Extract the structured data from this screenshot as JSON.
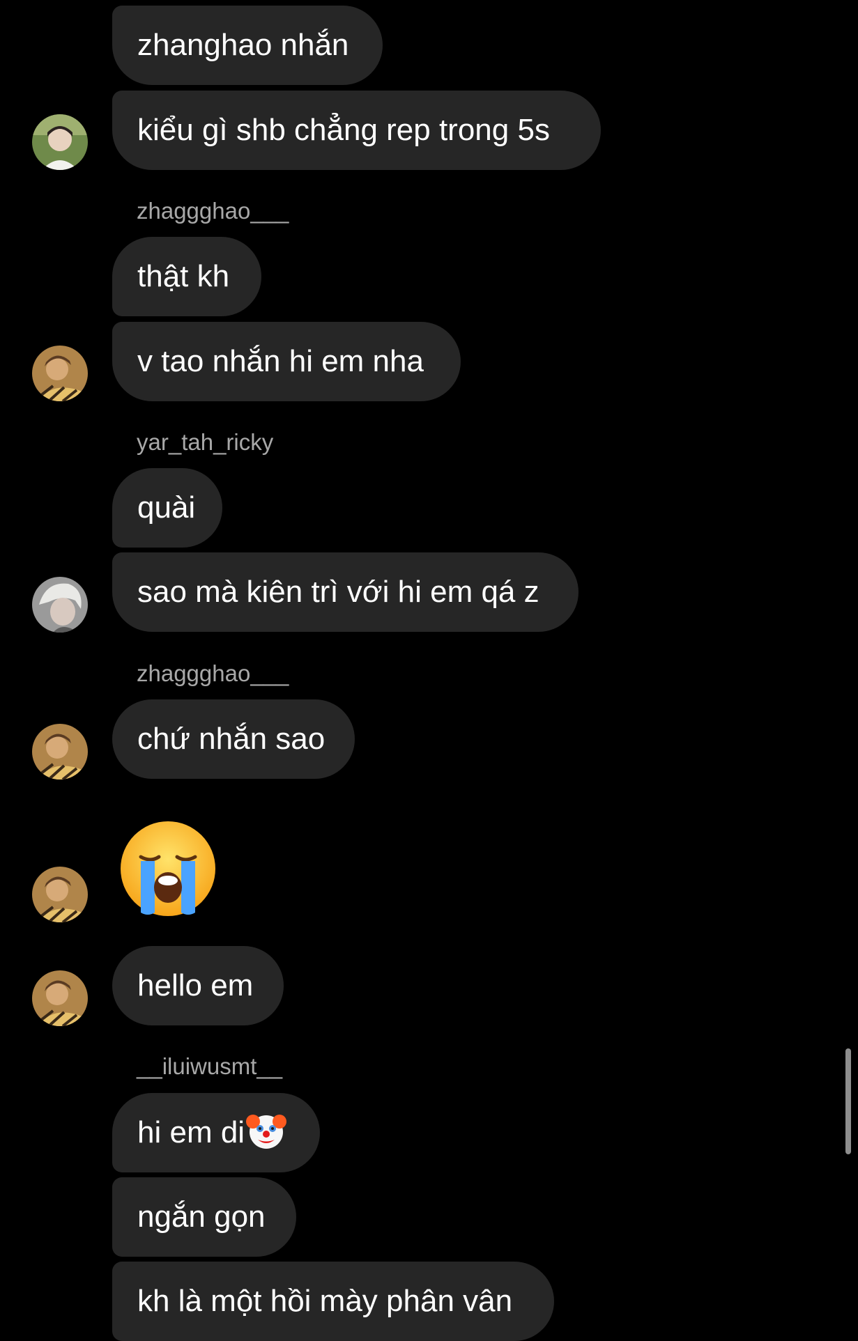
{
  "chat": {
    "messages": [
      {
        "text": "zhanghao nhắn"
      },
      {
        "text": "kiểu gì shb chẳng rep trong 5s"
      },
      {
        "sender": "zhaggghao___"
      },
      {
        "text": "thật kh"
      },
      {
        "text": "v tao nhắn hi em nha"
      },
      {
        "sender": "yar_tah_ricky"
      },
      {
        "text": "quài"
      },
      {
        "text": "sao mà kiên trì với hi em qá z"
      },
      {
        "sender": "zhaggghao___"
      },
      {
        "text": "chứ nhắn sao"
      },
      {
        "emoji": "loudly-crying-face-emoji"
      },
      {
        "text": "hello em"
      },
      {
        "sender": "__iluiwusmt__"
      },
      {
        "text": "hi em di"
      },
      {
        "text": "ngắn gọn"
      },
      {
        "text": "kh là một hồi mày phân vân"
      }
    ],
    "inline_emoji": "clown-face-emoji"
  },
  "colors": {
    "background": "#000000",
    "bubble": "#262626",
    "text": "#ffffff",
    "sender_name": "#a8a8a8",
    "scrollbar": "#8e8e8e"
  }
}
